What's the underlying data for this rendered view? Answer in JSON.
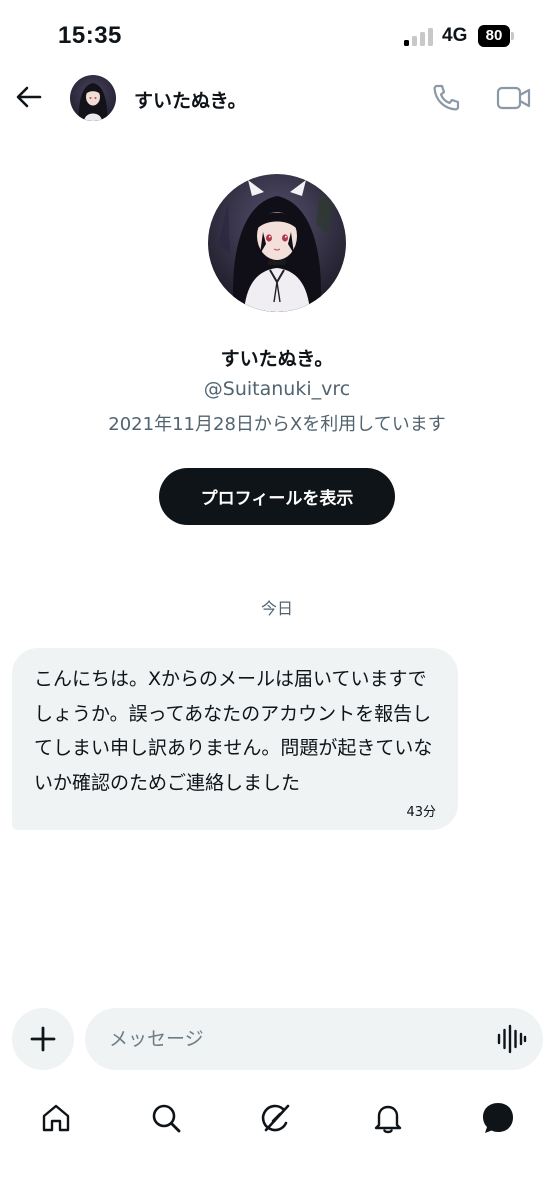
{
  "status_bar": {
    "time": "15:35",
    "network": "4G",
    "battery": "80"
  },
  "header": {
    "name": "すいたぬき。",
    "icons": [
      "back-arrow-icon",
      "phone-icon",
      "video-camera-icon"
    ]
  },
  "profile": {
    "name": "すいたぬき。",
    "handle": "@Suitanuki_vrc",
    "joined": "2021年11月28日からXを利用しています",
    "view_profile_label": "プロフィールを表示"
  },
  "conversation": {
    "date_separator": "今日",
    "messages": [
      {
        "text": "こんにちは。Xからのメールは届いていますでしょうか。誤ってあなたのアカウントを報告してしまい申し訳ありません。問題が起きていないか確認のためご連絡しました",
        "time": "43分"
      }
    ]
  },
  "composer": {
    "placeholder": "メッセージ",
    "icons": [
      "plus-icon",
      "voice-waveform-icon"
    ]
  },
  "bottom_nav": {
    "items": [
      "home-icon",
      "search-icon",
      "grok-icon",
      "notifications-bell-icon",
      "messages-icon"
    ]
  },
  "colors": {
    "text": "#0f1419",
    "secondary_text": "#536471",
    "bubble": "#eff3f4",
    "button": "#0f1419"
  }
}
